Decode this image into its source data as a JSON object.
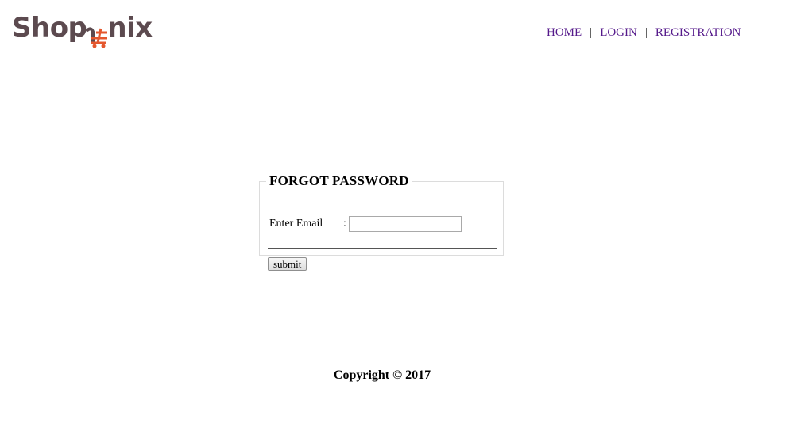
{
  "logo": {
    "text_before": "Shop",
    "text_after": "nix",
    "cart_icon": "shopping-cart-icon",
    "cart_color": "#e4572e",
    "text_color": "#5c4a4f"
  },
  "nav": {
    "items": [
      {
        "label": "HOME"
      },
      {
        "label": "LOGIN"
      },
      {
        "label": "REGISTRATION"
      }
    ],
    "separator": "|",
    "link_color": "#551a8b"
  },
  "form": {
    "legend": "FORGOT PASSWORD",
    "email_label": "Enter Email",
    "colon": ":",
    "email_value": "",
    "submit_label": "submit"
  },
  "footer": {
    "copyright": "Copyright © 2017"
  }
}
